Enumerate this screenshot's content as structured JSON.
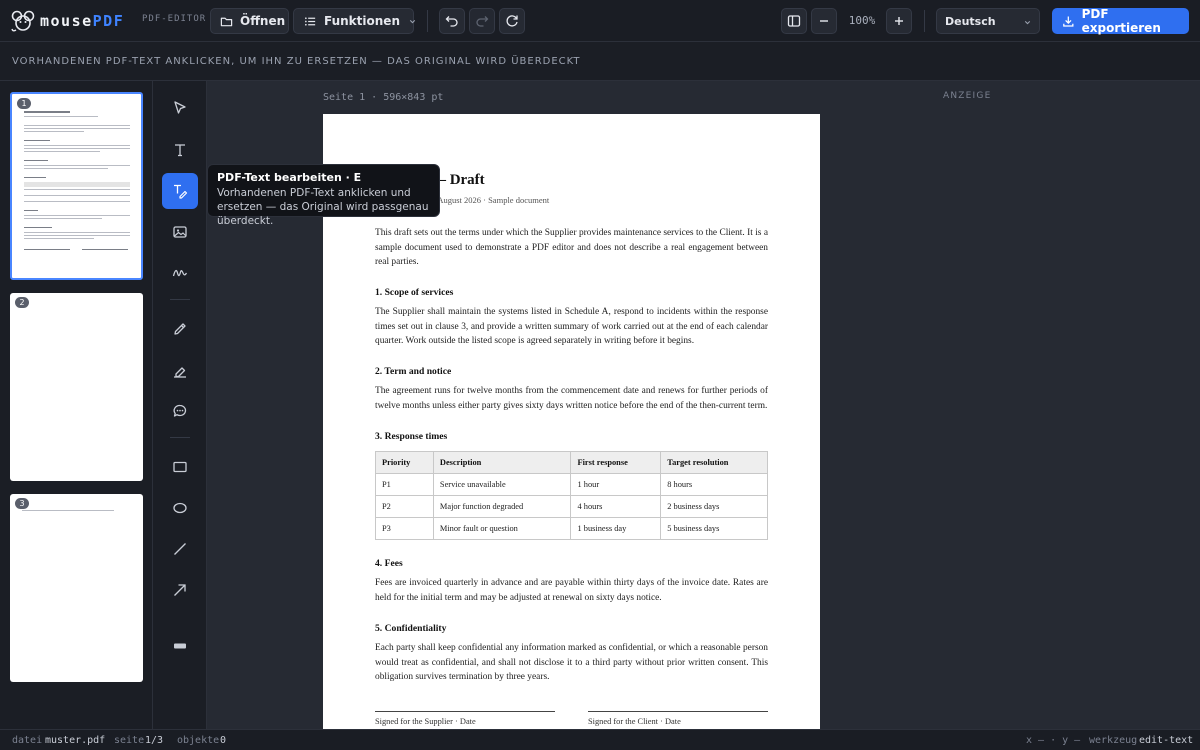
{
  "app": {
    "brand_main": "mouse",
    "brand_accent": "PDF",
    "sublabel": "PDF-EDITOR"
  },
  "toolbar": {
    "open_label": "Öffnen",
    "functions_label": "Funktionen",
    "zoom": "100%",
    "language": "Deutsch",
    "export_label": "PDF exportieren"
  },
  "hint": "VORHANDENEN PDF-TEXT ANKLICKEN, UM IHN ZU ERSETZEN — DAS ORIGINAL WIRD ÜBERDECKT",
  "thumbnails": [
    {
      "number": "1",
      "active": true
    },
    {
      "number": "2",
      "active": false
    },
    {
      "number": "3",
      "active": false
    }
  ],
  "tools": [
    {
      "name": "select",
      "icon": "cursor-icon"
    },
    {
      "name": "text",
      "icon": "text-icon"
    },
    {
      "name": "edit-text",
      "icon": "edit-text-icon",
      "active": true
    },
    {
      "name": "image",
      "icon": "image-icon"
    },
    {
      "name": "signature",
      "icon": "signature-icon"
    },
    {
      "name": "pen",
      "icon": "pen-icon"
    },
    {
      "name": "highlighter",
      "icon": "highlighter-icon"
    },
    {
      "name": "comment",
      "icon": "comment-icon"
    },
    {
      "name": "rectangle",
      "icon": "rectangle-icon"
    },
    {
      "name": "ellipse",
      "icon": "ellipse-icon"
    },
    {
      "name": "line",
      "icon": "line-icon"
    },
    {
      "name": "arrow",
      "icon": "arrow-icon"
    },
    {
      "name": "redact",
      "icon": "redact-icon"
    }
  ],
  "tooltip": {
    "title": "PDF-Text bearbeiten · E",
    "body": "Vorhandenen PDF-Text anklicken und ersetzen — das Original wird passgenau überdeckt."
  },
  "canvas": {
    "page_label": "Seite 1 · 596×843 pt",
    "display_label": "ANZEIGE"
  },
  "document": {
    "title_visible": "reement — Draft",
    "meta_visible": "014 · Prepared 12 August 2026 · Sample document",
    "intro": "This draft sets out the terms under which the Supplier provides maintenance services to the Client. It is a sample document used to demonstrate a PDF editor and does not describe a real engagement between real parties.",
    "s1_heading": "1. Scope of services",
    "s1_text": "The Supplier shall maintain the systems listed in Schedule A, respond to incidents within the response times set out in clause 3, and provide a written summary of work carried out at the end of each calendar quarter. Work outside the listed scope is agreed separately in writing before it begins.",
    "s2_heading": "2. Term and notice",
    "s2_text": "The agreement runs for twelve months from the commencement date and renews for further periods of twelve months unless either party gives sixty days written notice before the end of the then-current term.",
    "s3_heading": "3. Response times",
    "table": {
      "headers": [
        "Priority",
        "Description",
        "First response",
        "Target resolution"
      ],
      "rows": [
        [
          "P1",
          "Service unavailable",
          "1 hour",
          "8 hours"
        ],
        [
          "P2",
          "Major function degraded",
          "4 hours",
          "2 business days"
        ],
        [
          "P3",
          "Minor fault or question",
          "1 business day",
          "5 business days"
        ]
      ]
    },
    "s4_heading": "4. Fees",
    "s4_text": "Fees are invoiced quarterly in advance and are payable within thirty days of the invoice date. Rates are held for the initial term and may be adjusted at renewal on sixty days notice.",
    "s5_heading": "5. Confidentiality",
    "s5_text": "Each party shall keep confidential any information marked as confidential, or which a reasonable person would treat as confidential, and shall not disclose it to a third party without prior written consent. This obligation survives termination by three years.",
    "sig_supplier": "Signed for the Supplier · Date",
    "sig_client": "Signed for the Client · Date"
  },
  "status": {
    "file_label": "datei",
    "file_value": "muster.pdf",
    "page_label": "seite",
    "page_value": "1/3",
    "objects_label": "objekte",
    "objects_value": "0",
    "coords": "x — · y —",
    "tool_label": "werkzeug",
    "tool_value": "edit-text"
  },
  "colors": {
    "accent": "#2f6ff0",
    "background": "#1e2129"
  }
}
